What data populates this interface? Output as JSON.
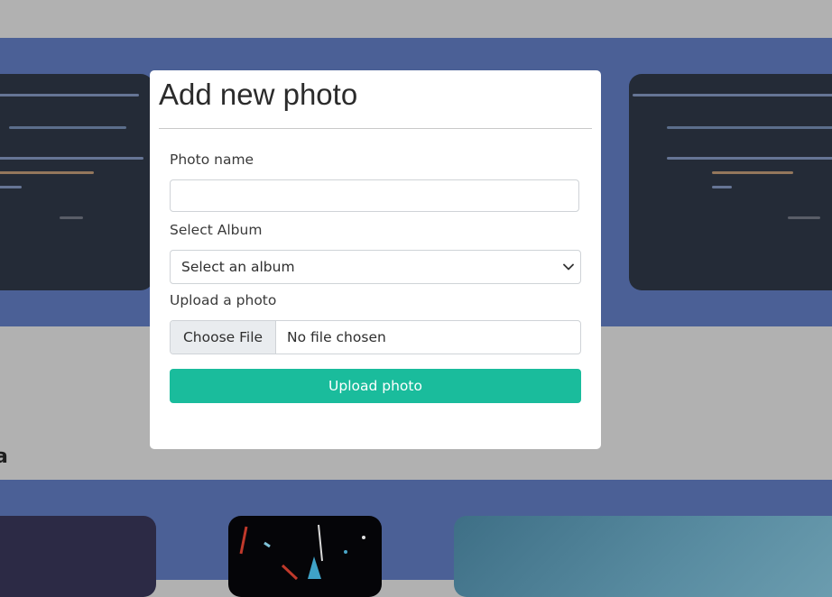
{
  "background": {
    "section_heading_fragment": "a",
    "band_color": "#4b6096",
    "backdrop_color": "#b1b1b1"
  },
  "modal": {
    "title": "Add new photo",
    "photo_name": {
      "label": "Photo name",
      "value": "",
      "placeholder": ""
    },
    "album": {
      "label": "Select Album",
      "selected": "Select an album",
      "icon": "chevron-down-icon"
    },
    "upload": {
      "label": "Upload a photo",
      "button": "Choose File",
      "status": "No file chosen"
    },
    "submit_label": "Upload photo",
    "accent_color": "#1abc9c"
  }
}
